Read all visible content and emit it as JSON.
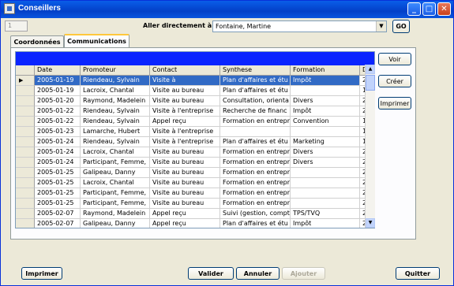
{
  "window": {
    "title": "Conseillers"
  },
  "record_id": "1",
  "nav": {
    "aller_label": "Aller directement à :",
    "aller_value": "Fontaine, Martine",
    "go_label": "GO"
  },
  "tabs": [
    {
      "label": "Coordonnées",
      "active": false
    },
    {
      "label": "Communications",
      "active": true
    }
  ],
  "grid": {
    "columns": [
      "Date",
      "Promoteur",
      "Contact",
      "Synthese",
      "Formation",
      "D"
    ],
    "rows": [
      [
        "2005-01-19",
        "Riendeau, Sylvain",
        "Visite à",
        "Plan d'affaires et étu",
        "Impôt",
        "2,"
      ],
      [
        "2005-01-19",
        "Lacroix, Chantal",
        "Visite au bureau",
        "Plan d'affaires et étu",
        "",
        "1,"
      ],
      [
        "2005-01-20",
        "Raymond, Madelein",
        "Visite au bureau",
        "Consultation, orienta",
        "Divers",
        "2,"
      ],
      [
        "2005-01-22",
        "Riendeau, Sylvain",
        "Visite à l'entreprise",
        "Recherche de financ",
        "Impôt",
        "2,"
      ],
      [
        "2005-01-22",
        "Riendeau, Sylvain",
        "Appel reçu",
        "Formation en entrepr",
        "Convention",
        "1,"
      ],
      [
        "2005-01-23",
        "Lamarche, Hubert",
        "Visite à l'entreprise",
        "",
        "",
        "1,"
      ],
      [
        "2005-01-24",
        "Riendeau, Sylvain",
        "Visite à l'entreprise",
        "Plan d'affaires et étu",
        "Marketing",
        "1,"
      ],
      [
        "2005-01-24",
        "Lacroix, Chantal",
        "Visite au bureau",
        "Formation en entrepr",
        "Divers",
        "2,"
      ],
      [
        "2005-01-24",
        "Participant, Femme,",
        "Visite au bureau",
        "Formation en entrepr",
        "Divers",
        "2,"
      ],
      [
        "2005-01-25",
        "Galipeau, Danny",
        "Visite au bureau",
        "Formation en entrepr",
        "",
        "2,"
      ],
      [
        "2005-01-25",
        "Lacroix, Chantal",
        "Visite au bureau",
        "Formation en entrepr",
        "",
        "2,"
      ],
      [
        "2005-01-25",
        "Participant, Femme,",
        "Visite au bureau",
        "Formation en entrepr",
        "",
        "2,"
      ],
      [
        "2005-01-25",
        "Participant, Femme,",
        "Visite au bureau",
        "Formation en entrepr",
        "",
        "2,"
      ],
      [
        "2005-02-07",
        "Raymond, Madelein",
        "Appel reçu",
        "Suivi (gestion, compt",
        "TPS/TVQ",
        "2,"
      ],
      [
        "2005-02-07",
        "Galipeau, Danny",
        "Appel reçu",
        "Plan d'affaires et étu",
        "Impôt",
        "2,"
      ]
    ]
  },
  "side_buttons": {
    "voir": "Voir",
    "creer": "Créer",
    "imprimer": "Imprimer"
  },
  "bottom_buttons": {
    "imprimer": "Imprimer",
    "valider": "Valider",
    "annuler": "Annuler",
    "ajouter": "Ajouter",
    "quitter": "Quitter"
  }
}
